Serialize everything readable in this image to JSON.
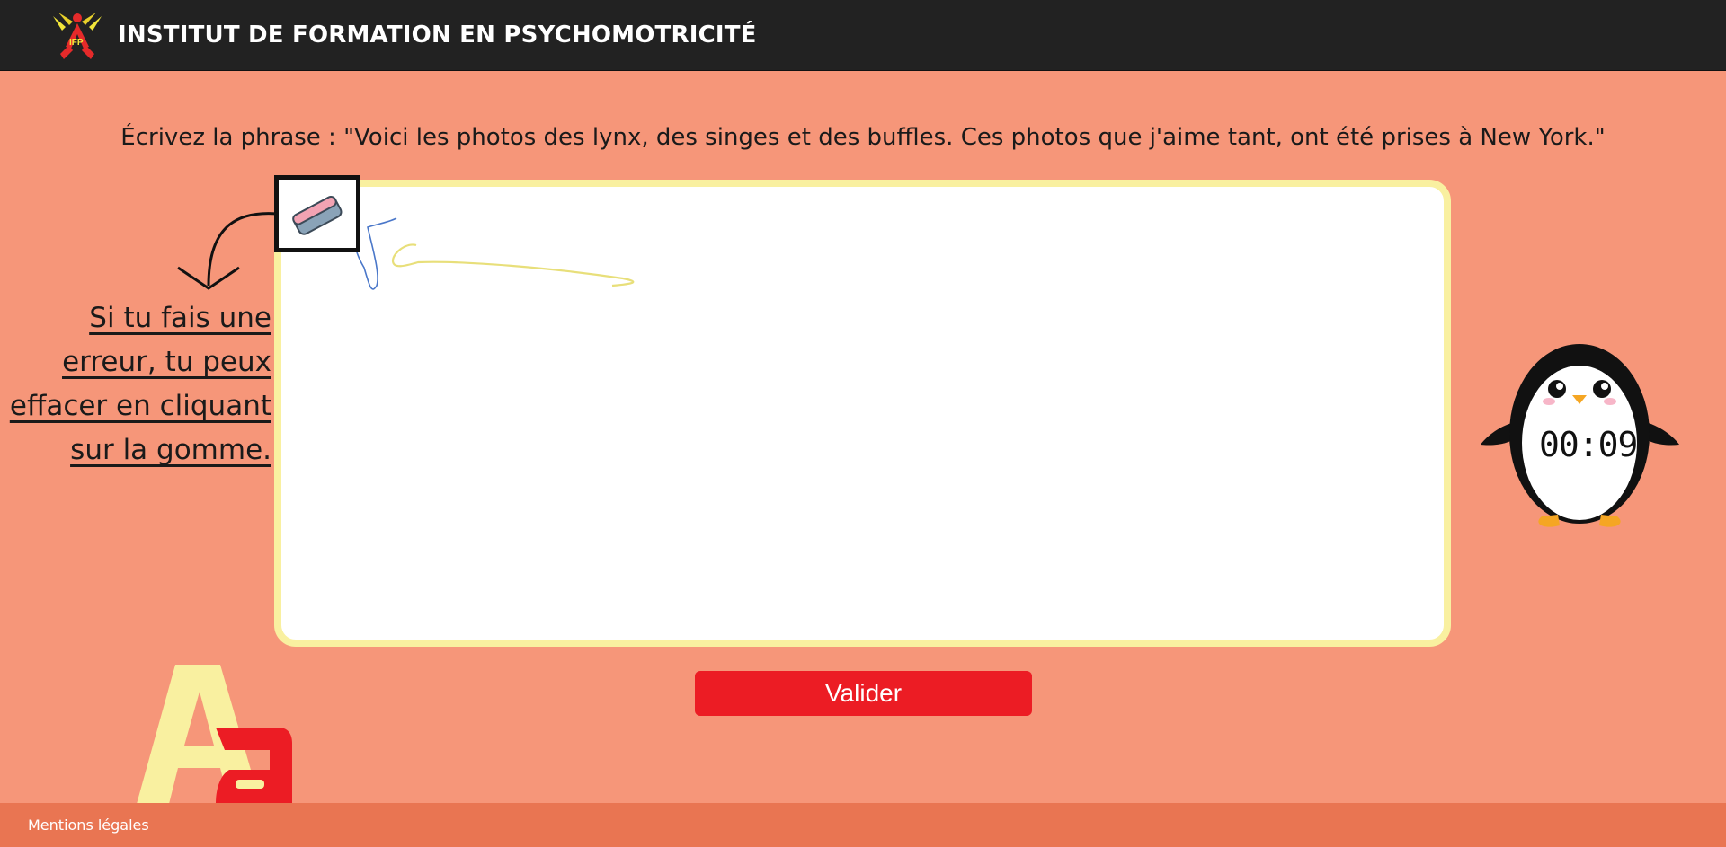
{
  "header": {
    "logo_icon": "ifp-logo-icon",
    "title": "INSTITUT DE FORMATION EN PSYCHOMOTRICITÉ"
  },
  "exercise": {
    "instruction": "Écrivez la phrase : \"Voici les photos des lynx, des singes et des buffles. Ces photos que j'aime tant, ont été prises à New York.\"",
    "hint_lines": [
      "Si tu fais une",
      "erreur, tu peux",
      "effacer en cliquant",
      "sur la gomme."
    ],
    "eraser_icon": "eraser-icon",
    "timer": "00:09",
    "validate_label": "Valider"
  },
  "colors": {
    "background": "#f69679",
    "header": "#222222",
    "canvas_border": "#f9f0a0",
    "button": "#ec1c24",
    "footer": "#e97552",
    "stroke_blue": "#4a77c9",
    "stroke_yellow": "#e8df7a"
  },
  "footer": {
    "legal_link": "Mentions légales"
  }
}
